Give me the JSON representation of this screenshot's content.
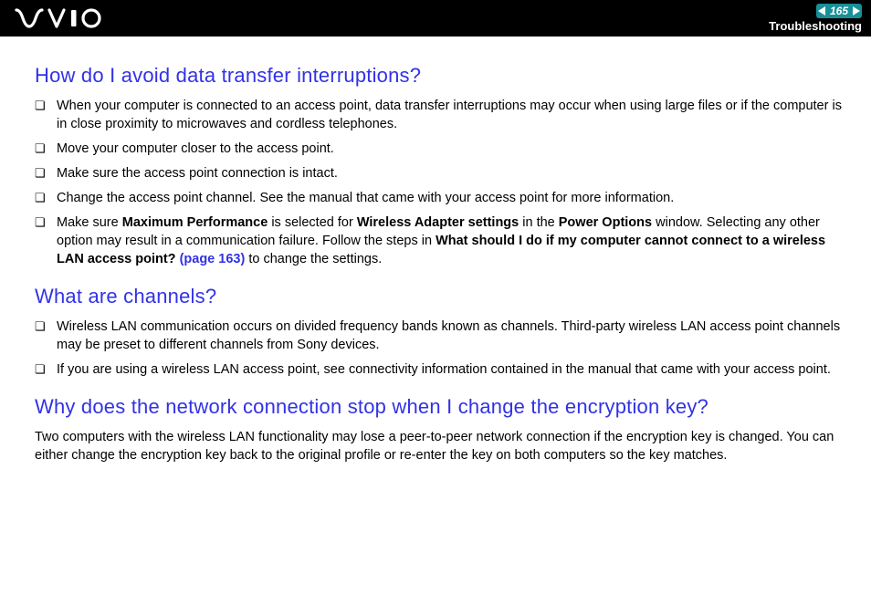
{
  "header": {
    "page_number": "165",
    "section": "Troubleshooting"
  },
  "content": {
    "h1": "How do I avoid data transfer interruptions?",
    "q1_items": [
      {
        "text": "When your computer is connected to an access point, data transfer interruptions may occur when using large files or if the computer is in close proximity to microwaves and cordless telephones."
      },
      {
        "text": "Move your computer closer to the access point."
      },
      {
        "text": "Make sure the access point connection is intact."
      },
      {
        "text": "Change the access point channel. See the manual that came with your access point for more information."
      }
    ],
    "q1_last": {
      "pre": "Make sure ",
      "b1": "Maximum Performance",
      "mid1": " is selected for ",
      "b2": "Wireless Adapter settings",
      "mid2": " in the ",
      "b3": "Power Options",
      "mid3": " window. Selecting any other option may result in a communication failure. Follow the steps in ",
      "b4": "What should I do if my computer cannot connect to a wireless LAN access point? ",
      "link": "(page 163)",
      "post": " to change the settings."
    },
    "h2": "What are channels?",
    "q2_items": [
      {
        "text": "Wireless LAN communication occurs on divided frequency bands known as channels. Third-party wireless LAN access point channels may be preset to different channels from Sony devices."
      },
      {
        "text": "If you are using a wireless LAN access point, see connectivity information contained in the manual that came with your access point."
      }
    ],
    "h3": "Why does the network connection stop when I change the encryption key?",
    "q3_para": "Two computers with the wireless LAN functionality may lose a peer-to-peer network connection if the encryption key is changed. You can either change the encryption key back to the original profile or re-enter the key on both computers so the key matches."
  }
}
